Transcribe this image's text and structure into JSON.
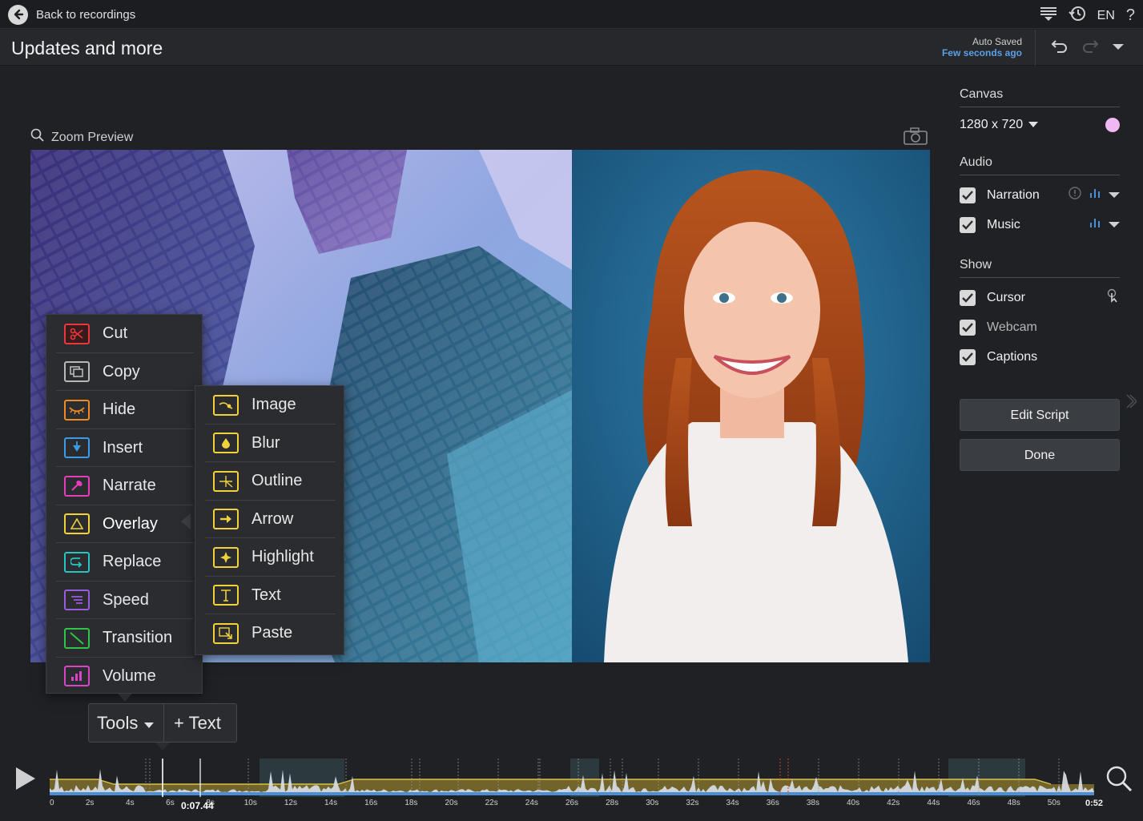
{
  "topbar": {
    "back_label": "Back to recordings",
    "language": "EN",
    "help_label": "?"
  },
  "titlebar": {
    "title": "Updates and more",
    "autosave_label": "Auto Saved",
    "autosave_time": "Few seconds ago"
  },
  "preview": {
    "zoom_label": "Zoom Preview"
  },
  "sidebar": {
    "canvas": {
      "title": "Canvas",
      "size": "1280 x 720",
      "background_color": "#f0b8f2"
    },
    "audio": {
      "title": "Audio",
      "items": [
        {
          "label": "Narration",
          "checked": true
        },
        {
          "label": "Music",
          "checked": true
        }
      ]
    },
    "show": {
      "title": "Show",
      "items": [
        {
          "label": "Cursor",
          "checked": true
        },
        {
          "label": "Webcam",
          "checked": true
        },
        {
          "label": "Captions",
          "checked": true
        }
      ]
    },
    "edit_script_label": "Edit Script",
    "done_label": "Done"
  },
  "tools_menu": {
    "items": [
      {
        "label": "Cut",
        "icon": "scissors-icon",
        "color": "#e8383d"
      },
      {
        "label": "Copy",
        "icon": "copy-icon",
        "color": "#b8b8b8"
      },
      {
        "label": "Hide",
        "icon": "eye-closed-icon",
        "color": "#f08a24"
      },
      {
        "label": "Insert",
        "icon": "insert-icon",
        "color": "#3b9be8"
      },
      {
        "label": "Narrate",
        "icon": "microphone-icon",
        "color": "#e83db8"
      },
      {
        "label": "Overlay",
        "icon": "overlay-icon",
        "color": "#f2d23a"
      },
      {
        "label": "Replace",
        "icon": "replace-icon",
        "color": "#27c4c4"
      },
      {
        "label": "Speed",
        "icon": "speed-icon",
        "color": "#9a5ce0"
      },
      {
        "label": "Transition",
        "icon": "transition-icon",
        "color": "#2fc44a"
      },
      {
        "label": "Volume",
        "icon": "volume-icon",
        "color": "#d845c8"
      }
    ],
    "active": "Overlay"
  },
  "overlay_submenu": {
    "items": [
      {
        "label": "Image",
        "icon": "image-icon"
      },
      {
        "label": "Blur",
        "icon": "blur-icon"
      },
      {
        "label": "Outline",
        "icon": "outline-icon"
      },
      {
        "label": "Arrow",
        "icon": "arrow-icon"
      },
      {
        "label": "Highlight",
        "icon": "highlight-icon"
      },
      {
        "label": "Text",
        "icon": "text-icon"
      },
      {
        "label": "Paste",
        "icon": "paste-icon"
      }
    ],
    "color": "#f2d23a"
  },
  "toolbar": {
    "tools_label": "Tools",
    "add_text_label": "+ Text"
  },
  "timeline": {
    "ticks": [
      "0",
      "2s",
      "4s",
      "6s",
      "8s",
      "10s",
      "12s",
      "14s",
      "16s",
      "18s",
      "20s",
      "22s",
      "24s",
      "26s",
      "28s",
      "30s",
      "32s",
      "34s",
      "36s",
      "38s",
      "40s",
      "42s",
      "44s",
      "46s",
      "48s",
      "50s",
      "0:52"
    ],
    "playhead_time": "0:07.44"
  }
}
